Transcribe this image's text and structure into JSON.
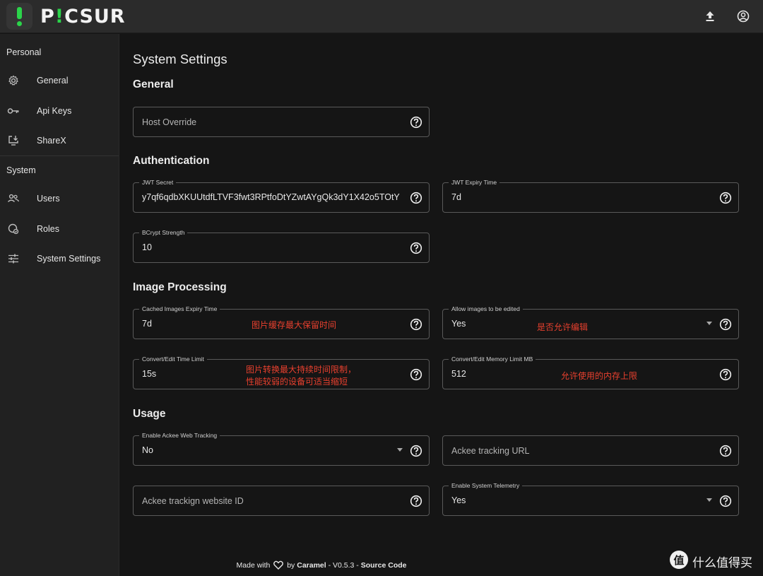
{
  "app": {
    "logo_prefix": "P",
    "logo_accent": "!",
    "logo_rest": "CSUR",
    "accent_color": "#2bd44a"
  },
  "topbar": {
    "upload_icon": "upload-icon",
    "account_icon": "account-circle-icon"
  },
  "sidebar": {
    "personal_header": "Personal",
    "system_header": "System",
    "personal_items": [
      {
        "label": "General",
        "icon": "gear-icon"
      },
      {
        "label": "Api Keys",
        "icon": "key-icon"
      },
      {
        "label": "ShareX",
        "icon": "install-desktop-icon"
      }
    ],
    "system_items": [
      {
        "label": "Users",
        "icon": "users-icon"
      },
      {
        "label": "Roles",
        "icon": "roles-icon"
      },
      {
        "label": "System Settings",
        "icon": "tune-icon"
      }
    ]
  },
  "main": {
    "title": "System Settings",
    "sections": {
      "general": "General",
      "authentication": "Authentication",
      "image_processing": "Image Processing",
      "usage": "Usage"
    },
    "fields": {
      "host_override": {
        "placeholder": "Host Override"
      },
      "jwt_secret": {
        "label": "JWT Secret",
        "value": "y7qf6qdbXKUUtdfLTVF3fwt3RPtfoDtYZwtAYgQk3dY1X42o5TOtY"
      },
      "jwt_expiry": {
        "label": "JWT Expiry Time",
        "value": "7d"
      },
      "bcrypt": {
        "label": "BCrypt Strength",
        "value": "10"
      },
      "cached_expiry": {
        "label": "Cached Images Expiry Time",
        "value": "7d"
      },
      "allow_edit": {
        "label": "Allow images to be edited",
        "value": "Yes"
      },
      "convert_time": {
        "label": "Convert/Edit Time Limit",
        "value": "15s"
      },
      "convert_memory": {
        "label": "Convert/Edit Memory Limit MB",
        "value": "512"
      },
      "ackee_tracking": {
        "label": "Enable Ackee Web Tracking",
        "value": "No"
      },
      "ackee_url": {
        "placeholder": "Ackee tracking URL"
      },
      "ackee_site_id": {
        "placeholder": "Ackee trackign website ID"
      },
      "telemetry": {
        "label": "Enable System Telemetry",
        "value": "Yes"
      }
    },
    "annotations": {
      "cached_expiry": "图片缓存最大保留时间",
      "allow_edit": "是否允许编辑",
      "convert_time_1": "图片转换最大持续时间限制，",
      "convert_time_2": "性能较弱的设备可适当缩短",
      "convert_memory": "允许使用的内存上限",
      "color": "#e8402e"
    }
  },
  "footer": {
    "made_with": "Made with",
    "by": "by",
    "author": "Caramel",
    "sep1": " - V0.5.3 - ",
    "source": "Source Code"
  },
  "watermark": {
    "glyph": "值",
    "text": "什么值得买"
  }
}
